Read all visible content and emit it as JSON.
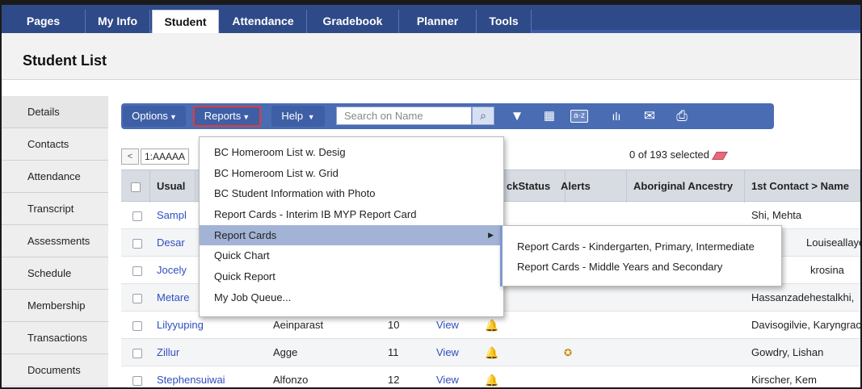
{
  "topnav": {
    "tabs": [
      {
        "label": "Pages"
      },
      {
        "label": "My Info"
      },
      {
        "label": "Student"
      },
      {
        "label": "Attendance"
      },
      {
        "label": "Gradebook"
      },
      {
        "label": "Planner"
      },
      {
        "label": "Tools"
      }
    ],
    "active_tab": "Student"
  },
  "page": {
    "title": "Student List"
  },
  "sidebar": {
    "items": [
      {
        "label": "Details"
      },
      {
        "label": "Contacts"
      },
      {
        "label": "Attendance"
      },
      {
        "label": "Transcript"
      },
      {
        "label": "Assessments"
      },
      {
        "label": "Schedule"
      },
      {
        "label": "Membership"
      },
      {
        "label": "Transactions"
      },
      {
        "label": "Documents"
      }
    ]
  },
  "toolbar": {
    "options_label": "Options",
    "reports_label": "Reports",
    "help_label": "Help",
    "search_placeholder": "Search on Name",
    "icons": [
      "magnifier-icon",
      "filter-icon",
      "grid-icon",
      "sort-az-icon",
      "chart-icon",
      "mail-icon",
      "print-icon"
    ]
  },
  "pager": {
    "prev_label": "<",
    "select_value": "1:AAAAA",
    "selected_count": "0 of 193 selected"
  },
  "table": {
    "headers": [
      "Usual",
      "ckStatus",
      "Alerts",
      "Aboriginal Ancestry",
      "1st Contact > Name"
    ],
    "rows": [
      {
        "usual": "Sampl",
        "last": "",
        "grade": "",
        "view": "",
        "contact": "Shi, Mehta"
      },
      {
        "usual": "Desar",
        "last": "",
        "grade": "",
        "view": "",
        "contact": "Louiseallaye"
      },
      {
        "usual": "Jocely",
        "last": "",
        "grade": "",
        "view": "",
        "contact": "krosina"
      },
      {
        "usual": "Metare",
        "last": "",
        "grade": "",
        "view": "",
        "contact": "Hassanzadehestalkhi,"
      },
      {
        "usual": "Lilyyuping",
        "last": "Aeinparast",
        "grade": "10",
        "view": "View",
        "contact": "Davisogilvie, Karyngrac"
      },
      {
        "usual": "Zillur",
        "last": "Agge",
        "grade": "11",
        "view": "View",
        "contact": "Gowdry, Lishan"
      },
      {
        "usual": "Stephensuiwai",
        "last": "Alfonzo",
        "grade": "12",
        "view": "View",
        "contact": "Kirscher, Kem"
      }
    ]
  },
  "reports_menu": {
    "items": [
      "BC Homeroom List w. Desig",
      "BC Homeroom List w. Grid",
      "BC Student Information with Photo",
      "Report Cards - Interim IB MYP Report Card",
      "Report Cards",
      "Quick Chart",
      "Quick Report",
      "My Job Queue..."
    ],
    "highlighted": "Report Cards"
  },
  "report_cards_submenu": {
    "items": [
      "Report Cards - Kindergarten, Primary, Intermediate",
      "Report Cards - Middle Years and Secondary"
    ]
  },
  "colors": {
    "nav_bg": "#2f4a88",
    "toolbar_bg": "#4a6cb3",
    "link": "#2f4fbf",
    "highlight": "#a3b3d6",
    "reports_outline": "#e23a3a"
  }
}
